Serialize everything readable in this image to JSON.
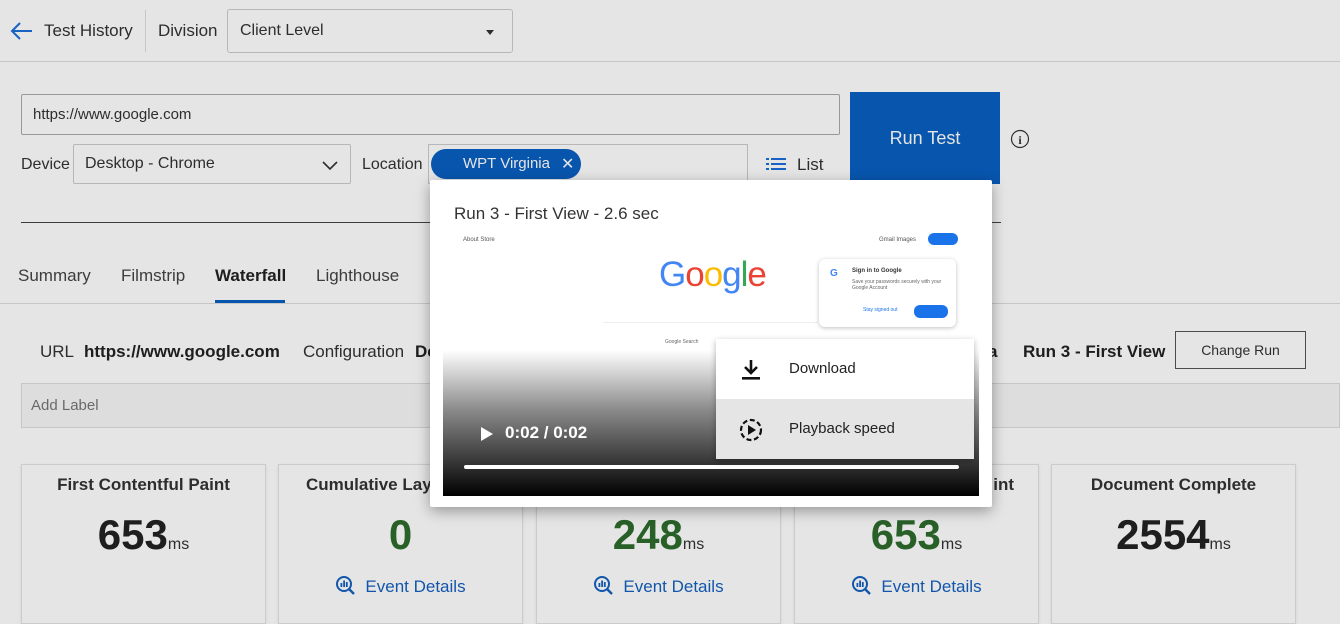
{
  "header": {
    "back_title": "Test History",
    "division_label": "Division",
    "division_value": "Client Level"
  },
  "test_form": {
    "url_value": "https://www.google.com",
    "run_button": "Run Test",
    "device_label": "Device",
    "device_value": "Desktop - Chrome",
    "location_label": "Location",
    "location_chip": "WPT Virginia",
    "list_label": "List"
  },
  "tabs": [
    {
      "label": "Summary"
    },
    {
      "label": "Filmstrip"
    },
    {
      "label": "Waterfall",
      "active": true
    },
    {
      "label": "Lighthouse"
    }
  ],
  "run_info": {
    "url_key": "URL",
    "url_value": "https://www.google.com",
    "config_key": "Configuration",
    "config_value_partial": "De",
    "run_partial": "a",
    "run_value": "Run 3 - First View",
    "change_run": "Change Run"
  },
  "label_input": {
    "placeholder": "Add Label"
  },
  "metrics": [
    {
      "title": "First Contentful Paint",
      "value": "653",
      "unit": "ms",
      "event": ""
    },
    {
      "title": "Cumulative Lay",
      "value": "0",
      "unit": "",
      "event": "Event Details"
    },
    {
      "title": "",
      "value": "248",
      "unit": "ms",
      "event": "Event Details"
    },
    {
      "title": "int",
      "value": "653",
      "unit": "ms",
      "event": "Event Details"
    },
    {
      "title": "Document Complete",
      "value": "2554",
      "unit": "ms",
      "event": ""
    }
  ],
  "video_modal": {
    "title": "Run 3 - First View - 2.6 sec",
    "time": "0:02 / 0:02",
    "frame": {
      "top_left": "About   Store",
      "top_right": "Gmail   Images",
      "logo": [
        "G",
        "o",
        "o",
        "g",
        "l",
        "e"
      ],
      "lucky": "Google Search",
      "card_title": "Sign in to Google",
      "card_desc": "Save your passwords securely with your Google Account",
      "card_link": "Stay signed out"
    }
  },
  "context_menu": {
    "download": "Download",
    "playback_speed": "Playback speed"
  },
  "colors": {
    "accent": "#0a5fc2",
    "link": "#1560c0",
    "metric_green": "#2d6b2d"
  }
}
